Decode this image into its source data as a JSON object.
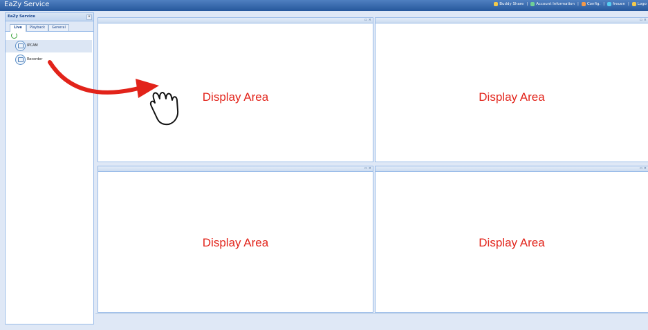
{
  "app": {
    "title": "EaZy Service"
  },
  "toplinks": [
    {
      "label": "Buddy Share",
      "icon": "buddy-share-icon",
      "color": "#f2c94c"
    },
    {
      "label": "Account Information",
      "icon": "account-icon",
      "color": "#6fcf97"
    },
    {
      "label": "Config.",
      "icon": "config-icon",
      "color": "#f2994a"
    },
    {
      "label": "freuen",
      "icon": "user-icon",
      "color": "#56ccf2"
    },
    {
      "label": "Logo",
      "icon": "logout-icon",
      "color": "#f2c94c"
    }
  ],
  "sidebar": {
    "title": "EaZy Service",
    "collapse": "«",
    "tabs": [
      {
        "label": "Live"
      },
      {
        "label": "Playback"
      },
      {
        "label": "General"
      }
    ],
    "devices": [
      {
        "label": "IPCAM"
      },
      {
        "label": "Recorder"
      }
    ]
  },
  "panes": [
    {
      "label": "Display Area",
      "controls": "▭ ×"
    },
    {
      "label": "Display Area",
      "controls": "▭ ×"
    },
    {
      "label": "Display Area",
      "controls": "▭ ×"
    },
    {
      "label": "Display Area",
      "controls": "▭ ×"
    }
  ]
}
